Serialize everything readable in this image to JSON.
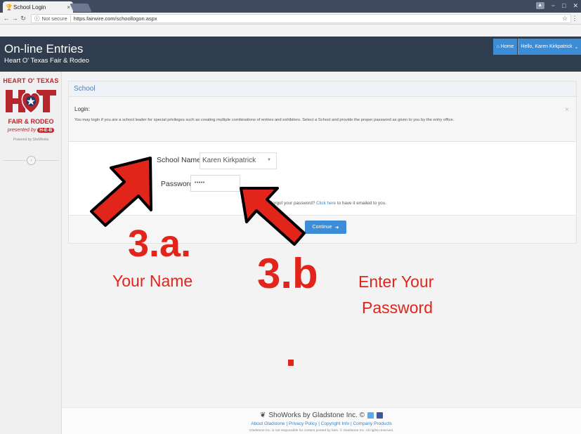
{
  "browser": {
    "tab_title": "School Login",
    "tab_close": "×",
    "url_info": "ⓘ",
    "security_label": "Not secure",
    "url": "https.fairwire.com/schoollogon.aspx"
  },
  "header": {
    "title": "On-line Entries",
    "subtitle": "Heart O' Texas Fair & Rodeo",
    "home_label": "Home",
    "user_label": "Hello, Karen Kirkpatrick"
  },
  "sidebar": {
    "logo_top": "HEART O' TEXAS",
    "logo_fair": "FAIR & RODEO",
    "logo_presented": "presented by",
    "logo_sponsor": "H-E-B",
    "powered_by": "Powered by ShoWorks"
  },
  "panel": {
    "heading": "School",
    "notice_title": "Login:",
    "notice_text": "You may login if you are a school leader for special privileges such as creating multiple combinations of entries and exhibitors. Select a School and provide the proper password as given to you by the entry office.",
    "notice_close": "×"
  },
  "form": {
    "school_label": "School Name",
    "school_value": "Karen Kirkpatrick",
    "password_label": "Password",
    "password_value": "•••••",
    "forgot_prefix": "Forgot your password?",
    "forgot_link": "Click here",
    "forgot_suffix": "to have it emailed to you.",
    "continue_label": "Continue"
  },
  "annotations": {
    "label_a": "3.a.",
    "caption_a": "Your Name",
    "label_b": "3.b",
    "caption_b_line1": "Enter Your",
    "caption_b_line2": "Password",
    "arrow_color": "#e1251b"
  },
  "footer": {
    "brand": "ShoWorks by Gladstone Inc. ©",
    "links": "About Gladstone | Privacy Policy | Copyright Info | Company Products",
    "disclaimer": "Gladstone Inc. is not responsible for content posted by fairs. © Gladstone Inc. All rights reserved."
  },
  "colors": {
    "header_bg": "#2f3d4e",
    "accent": "#3c8dd6",
    "brand_red": "#b5272c",
    "annotation_red": "#e1251b"
  }
}
